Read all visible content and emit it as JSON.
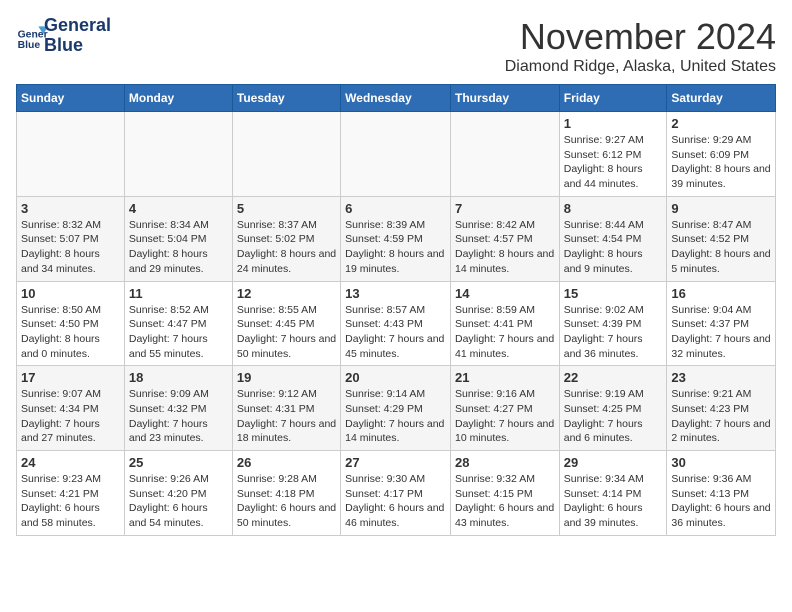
{
  "logo": {
    "line1": "General",
    "line2": "Blue"
  },
  "title": "November 2024",
  "location": "Diamond Ridge, Alaska, United States",
  "days_of_week": [
    "Sunday",
    "Monday",
    "Tuesday",
    "Wednesday",
    "Thursday",
    "Friday",
    "Saturday"
  ],
  "weeks": [
    [
      {
        "day": "",
        "info": ""
      },
      {
        "day": "",
        "info": ""
      },
      {
        "day": "",
        "info": ""
      },
      {
        "day": "",
        "info": ""
      },
      {
        "day": "",
        "info": ""
      },
      {
        "day": "1",
        "info": "Sunrise: 9:27 AM\nSunset: 6:12 PM\nDaylight: 8 hours and 44 minutes."
      },
      {
        "day": "2",
        "info": "Sunrise: 9:29 AM\nSunset: 6:09 PM\nDaylight: 8 hours and 39 minutes."
      }
    ],
    [
      {
        "day": "3",
        "info": "Sunrise: 8:32 AM\nSunset: 5:07 PM\nDaylight: 8 hours and 34 minutes."
      },
      {
        "day": "4",
        "info": "Sunrise: 8:34 AM\nSunset: 5:04 PM\nDaylight: 8 hours and 29 minutes."
      },
      {
        "day": "5",
        "info": "Sunrise: 8:37 AM\nSunset: 5:02 PM\nDaylight: 8 hours and 24 minutes."
      },
      {
        "day": "6",
        "info": "Sunrise: 8:39 AM\nSunset: 4:59 PM\nDaylight: 8 hours and 19 minutes."
      },
      {
        "day": "7",
        "info": "Sunrise: 8:42 AM\nSunset: 4:57 PM\nDaylight: 8 hours and 14 minutes."
      },
      {
        "day": "8",
        "info": "Sunrise: 8:44 AM\nSunset: 4:54 PM\nDaylight: 8 hours and 9 minutes."
      },
      {
        "day": "9",
        "info": "Sunrise: 8:47 AM\nSunset: 4:52 PM\nDaylight: 8 hours and 5 minutes."
      }
    ],
    [
      {
        "day": "10",
        "info": "Sunrise: 8:50 AM\nSunset: 4:50 PM\nDaylight: 8 hours and 0 minutes."
      },
      {
        "day": "11",
        "info": "Sunrise: 8:52 AM\nSunset: 4:47 PM\nDaylight: 7 hours and 55 minutes."
      },
      {
        "day": "12",
        "info": "Sunrise: 8:55 AM\nSunset: 4:45 PM\nDaylight: 7 hours and 50 minutes."
      },
      {
        "day": "13",
        "info": "Sunrise: 8:57 AM\nSunset: 4:43 PM\nDaylight: 7 hours and 45 minutes."
      },
      {
        "day": "14",
        "info": "Sunrise: 8:59 AM\nSunset: 4:41 PM\nDaylight: 7 hours and 41 minutes."
      },
      {
        "day": "15",
        "info": "Sunrise: 9:02 AM\nSunset: 4:39 PM\nDaylight: 7 hours and 36 minutes."
      },
      {
        "day": "16",
        "info": "Sunrise: 9:04 AM\nSunset: 4:37 PM\nDaylight: 7 hours and 32 minutes."
      }
    ],
    [
      {
        "day": "17",
        "info": "Sunrise: 9:07 AM\nSunset: 4:34 PM\nDaylight: 7 hours and 27 minutes."
      },
      {
        "day": "18",
        "info": "Sunrise: 9:09 AM\nSunset: 4:32 PM\nDaylight: 7 hours and 23 minutes."
      },
      {
        "day": "19",
        "info": "Sunrise: 9:12 AM\nSunset: 4:31 PM\nDaylight: 7 hours and 18 minutes."
      },
      {
        "day": "20",
        "info": "Sunrise: 9:14 AM\nSunset: 4:29 PM\nDaylight: 7 hours and 14 minutes."
      },
      {
        "day": "21",
        "info": "Sunrise: 9:16 AM\nSunset: 4:27 PM\nDaylight: 7 hours and 10 minutes."
      },
      {
        "day": "22",
        "info": "Sunrise: 9:19 AM\nSunset: 4:25 PM\nDaylight: 7 hours and 6 minutes."
      },
      {
        "day": "23",
        "info": "Sunrise: 9:21 AM\nSunset: 4:23 PM\nDaylight: 7 hours and 2 minutes."
      }
    ],
    [
      {
        "day": "24",
        "info": "Sunrise: 9:23 AM\nSunset: 4:21 PM\nDaylight: 6 hours and 58 minutes."
      },
      {
        "day": "25",
        "info": "Sunrise: 9:26 AM\nSunset: 4:20 PM\nDaylight: 6 hours and 54 minutes."
      },
      {
        "day": "26",
        "info": "Sunrise: 9:28 AM\nSunset: 4:18 PM\nDaylight: 6 hours and 50 minutes."
      },
      {
        "day": "27",
        "info": "Sunrise: 9:30 AM\nSunset: 4:17 PM\nDaylight: 6 hours and 46 minutes."
      },
      {
        "day": "28",
        "info": "Sunrise: 9:32 AM\nSunset: 4:15 PM\nDaylight: 6 hours and 43 minutes."
      },
      {
        "day": "29",
        "info": "Sunrise: 9:34 AM\nSunset: 4:14 PM\nDaylight: 6 hours and 39 minutes."
      },
      {
        "day": "30",
        "info": "Sunrise: 9:36 AM\nSunset: 4:13 PM\nDaylight: 6 hours and 36 minutes."
      }
    ]
  ]
}
